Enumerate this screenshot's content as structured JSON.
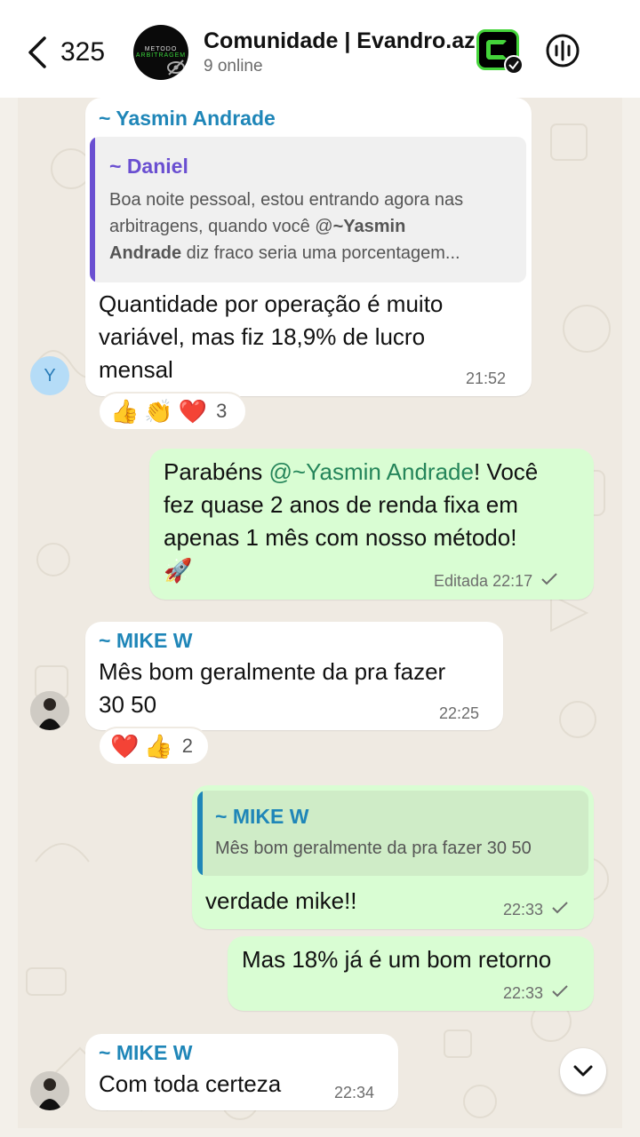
{
  "header": {
    "back_count": "325",
    "group_avatar_line1": "METODO",
    "group_avatar_line2": "ARBITRAGEM",
    "title": "Comunidade | Evandro.az",
    "subtitle": "9 online"
  },
  "colors": {
    "sender_blue": "#1f86b8",
    "sender_purple": "#6a4fd1",
    "mention_green": "#25855a",
    "outgoing_bubble": "#d9fdd3",
    "incoming_bubble": "#ffffff"
  },
  "messages": [
    {
      "sender": "~ Yasmin Andrade",
      "avatar_letter": "Y",
      "quote_sender": "~ Daniel",
      "quote_line1": "Boa noite pessoal, estou entrando agora nas",
      "quote_line2_pre": "arbitragens, quando você @",
      "quote_mention": "~Yasmin",
      "quote_line3_mention": "Andrade",
      "quote_line3_rest": "  diz fraco seria uma porcentagem...",
      "line1": "Quantidade por operação é muito",
      "line2": "variável, mas fiz 18,9% de lucro",
      "line3": "mensal",
      "time": "21:52",
      "reactions": [
        "👍",
        "👏",
        "❤️"
      ],
      "reaction_count": "3"
    },
    {
      "line1_pre": "Parabéns ",
      "mention": "@~Yasmin Andrade",
      "line1_post": "! Você",
      "line2": "fez quase 2 anos de renda fixa em",
      "line3": "apenas 1 mês com nosso método!",
      "emoji": "🚀",
      "edited_label": "Editada",
      "time": "22:17"
    },
    {
      "sender": "~ MIKE W",
      "line1": "Mês bom geralmente da pra fazer",
      "line2": "30 50",
      "time": "22:25",
      "reactions": [
        "❤️",
        "👍"
      ],
      "reaction_count": "2"
    },
    {
      "quote_sender": "~ MIKE W",
      "quote_text": "Mês bom geralmente da pra fazer 30 50",
      "text": "verdade mike!!",
      "time": "22:33"
    },
    {
      "text": "Mas 18% já é um bom retorno",
      "time": "22:33"
    },
    {
      "sender": "~ MIKE W",
      "text": "Com toda certeza",
      "time": "22:34"
    }
  ],
  "icons": {
    "back": "chevron-left-icon",
    "voice": "audio-wave-icon",
    "scroll_down": "chevron-down-icon",
    "read": "check-icon",
    "privacy": "eye-off-icon"
  }
}
